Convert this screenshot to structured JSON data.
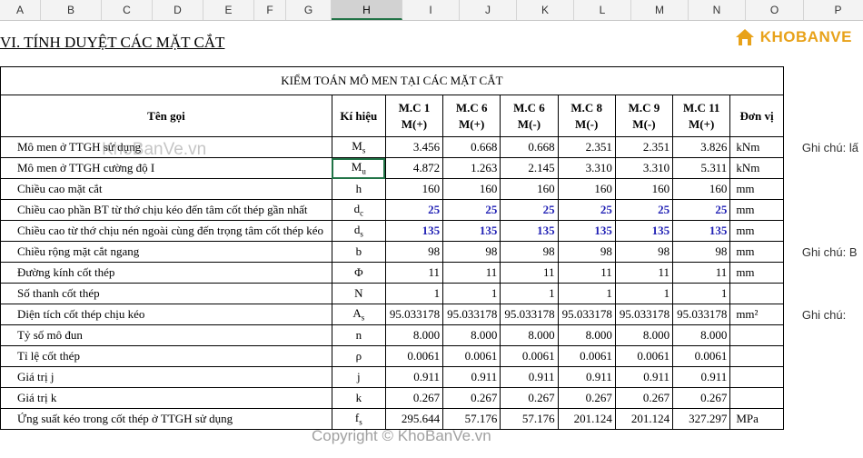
{
  "columns": [
    "A",
    "B",
    "C",
    "D",
    "E",
    "F",
    "G",
    "H",
    "I",
    "J",
    "K",
    "L",
    "M",
    "N",
    "O",
    "P"
  ],
  "selected_column": "H",
  "section_title": "VI. TÍNH DUYỆT CÁC MẶT CẮT",
  "logo_text": "KHOBANVE",
  "watermark": "KhoBanVe.vn",
  "copyright": "Copyright © KhoBanVe.vn",
  "table": {
    "caption": "KIỂM TOÁN MÔ MEN TẠI CÁC MẶT CẮT",
    "header": {
      "name": "Tên gọi",
      "symbol": "Kí hiệu",
      "sections": [
        {
          "line1": "M.C 1",
          "line2": "M(+)"
        },
        {
          "line1": "M.C 6",
          "line2": "M(+)"
        },
        {
          "line1": "M.C 6",
          "line2": "M(-)"
        },
        {
          "line1": "M.C 8",
          "line2": "M(-)"
        },
        {
          "line1": "M.C 9",
          "line2": "M(-)"
        },
        {
          "line1": "M.C 11",
          "line2": "M(+)"
        }
      ],
      "unit": "Đơn vị"
    },
    "rows": [
      {
        "name": "Mô men ở TTGH sử dụng",
        "sym": "M",
        "sub": "s",
        "values": [
          "3.456",
          "0.668",
          "0.668",
          "2.351",
          "2.351",
          "3.826"
        ],
        "unit": "kNm",
        "note": "Ghi chú: lấ"
      },
      {
        "name": "Mô men ở TTGH cường độ I",
        "sym": "M",
        "sub": "u",
        "values": [
          "4.872",
          "1.263",
          "2.145",
          "3.310",
          "3.310",
          "5.311"
        ],
        "unit": "kNm",
        "note": ""
      },
      {
        "name": "Chiều cao mặt cắt",
        "sym": "h",
        "sub": "",
        "values": [
          "160",
          "160",
          "160",
          "160",
          "160",
          "160"
        ],
        "unit": "mm",
        "note": ""
      },
      {
        "name": "Chiều cao phần BT từ thớ chịu kéo đến tâm cốt thép gần nhất",
        "sym": "d",
        "sub": "c",
        "values": [
          "25",
          "25",
          "25",
          "25",
          "25",
          "25"
        ],
        "unit": "mm",
        "note": "",
        "blue": true
      },
      {
        "name": "Chiều cao từ thớ chịu nén ngoài cùng đến trọng tâm cốt thép kéo",
        "sym": "d",
        "sub": "s",
        "values": [
          "135",
          "135",
          "135",
          "135",
          "135",
          "135"
        ],
        "unit": "mm",
        "note": "",
        "blue": true
      },
      {
        "name": "Chiều rộng mặt cắt ngang",
        "sym": "b",
        "sub": "",
        "values": [
          "98",
          "98",
          "98",
          "98",
          "98",
          "98"
        ],
        "unit": "mm",
        "note": "Ghi chú: B"
      },
      {
        "name": "Đường kính cốt thép",
        "sym": "Φ",
        "sub": "",
        "values": [
          "11",
          "11",
          "11",
          "11",
          "11",
          "11"
        ],
        "unit": "mm",
        "note": ""
      },
      {
        "name": "Số thanh cốt thép",
        "sym": "N",
        "sub": "",
        "values": [
          "1",
          "1",
          "1",
          "1",
          "1",
          "1"
        ],
        "unit": "",
        "note": ""
      },
      {
        "name": "Diện tích cốt thép chịu kéo",
        "sym": "A",
        "sub": "s",
        "values": [
          "95.033178",
          "95.033178",
          "95.033178",
          "95.033178",
          "95.033178",
          "95.033178"
        ],
        "unit": "mm²",
        "note": "Ghi chú:"
      },
      {
        "name": "Tỷ số mô đun",
        "sym": "n",
        "sub": "",
        "values": [
          "8.000",
          "8.000",
          "8.000",
          "8.000",
          "8.000",
          "8.000"
        ],
        "unit": "",
        "note": ""
      },
      {
        "name": "Tỉ lệ cốt thép",
        "sym": "ρ",
        "sub": "",
        "values": [
          "0.0061",
          "0.0061",
          "0.0061",
          "0.0061",
          "0.0061",
          "0.0061"
        ],
        "unit": "",
        "note": ""
      },
      {
        "name": "Giá trị j",
        "sym": "j",
        "sub": "",
        "values": [
          "0.911",
          "0.911",
          "0.911",
          "0.911",
          "0.911",
          "0.911"
        ],
        "unit": "",
        "note": ""
      },
      {
        "name": "Giá trị k",
        "sym": "k",
        "sub": "",
        "values": [
          "0.267",
          "0.267",
          "0.267",
          "0.267",
          "0.267",
          "0.267"
        ],
        "unit": "",
        "note": ""
      },
      {
        "name": "Ứng suất kéo trong cốt thép ở TTGH sử dụng",
        "sym": "f",
        "sub": "s",
        "values": [
          "295.644",
          "57.176",
          "57.176",
          "201.124",
          "201.124",
          "327.297"
        ],
        "unit": "MPa",
        "note": ""
      }
    ]
  },
  "colors": {
    "accent": "#217346",
    "value_blue": "#1f1fb4",
    "logo": "#e8a21a"
  }
}
